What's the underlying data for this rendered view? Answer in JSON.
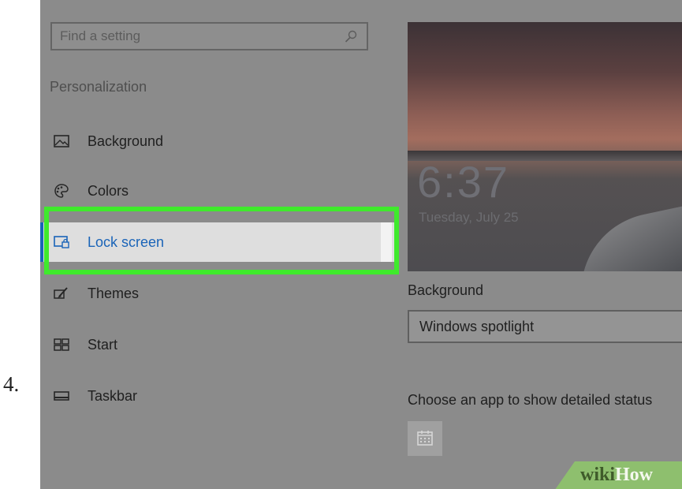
{
  "step": {
    "number": "4."
  },
  "search": {
    "placeholder": "Find a setting"
  },
  "sidebar": {
    "heading": "Personalization",
    "items": [
      {
        "label": "Background",
        "icon": "image-icon"
      },
      {
        "label": "Colors",
        "icon": "palette-icon"
      },
      {
        "label": "Lock screen",
        "icon": "lock-screen-icon",
        "selected": true
      },
      {
        "label": "Themes",
        "icon": "themes-icon"
      },
      {
        "label": "Start",
        "icon": "start-icon"
      },
      {
        "label": "Taskbar",
        "icon": "taskbar-icon"
      }
    ]
  },
  "preview": {
    "time": "6:37",
    "date": "Tuesday, July 25"
  },
  "background": {
    "label": "Background",
    "value": "Windows spotlight"
  },
  "status": {
    "label": "Choose an app to show detailed status",
    "app_icon": "calendar-icon"
  },
  "watermark": {
    "wiki": "wiki",
    "how": "How"
  },
  "colors": {
    "accent": "#1a64b8",
    "highlight": "#3fea2c",
    "panel": "#8b8b8b"
  }
}
